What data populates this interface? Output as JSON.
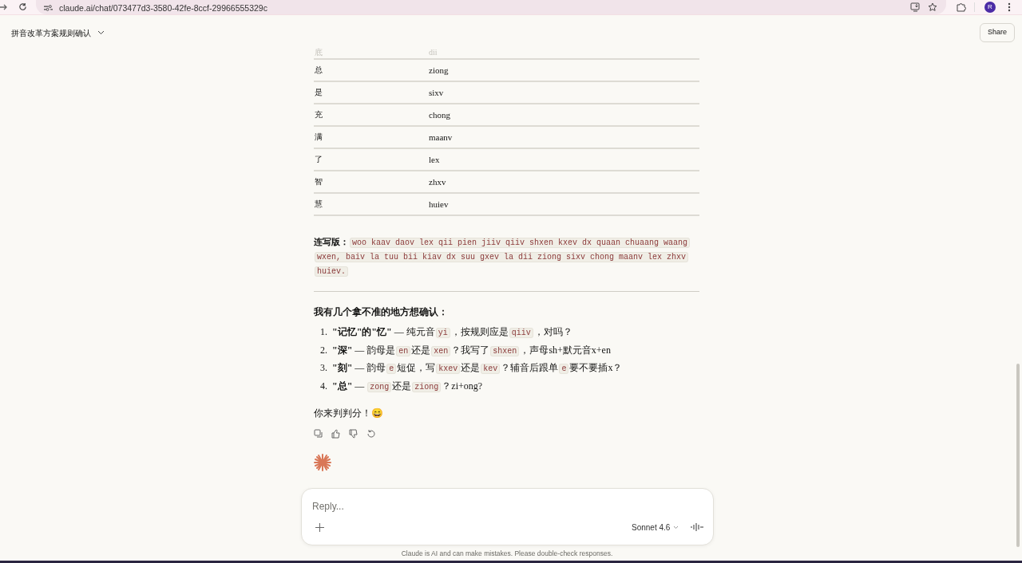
{
  "browser": {
    "url": "claude.ai/chat/073477d3-3580-42fe-8ccf-29966555329c",
    "avatar": "R"
  },
  "header": {
    "title": "拼音改革方案规则确认",
    "share": "Share"
  },
  "table": {
    "rows": [
      {
        "char": "底",
        "pinyin": "dii",
        "faded": true
      },
      {
        "char": "总",
        "pinyin": "ziong",
        "faded": false
      },
      {
        "char": "是",
        "pinyin": "sixv",
        "faded": false
      },
      {
        "char": "充",
        "pinyin": "chong",
        "faded": false
      },
      {
        "char": "满",
        "pinyin": "maanv",
        "faded": false
      },
      {
        "char": "了",
        "pinyin": "lex",
        "faded": false
      },
      {
        "char": "智",
        "pinyin": "zhxv",
        "faded": false
      },
      {
        "char": "慧",
        "pinyin": "huiev",
        "faded": false
      }
    ]
  },
  "continuous": [
    {
      "kind": "bold",
      "text": "连写版："
    },
    {
      "kind": "code",
      "text": "woo kaav daov lex qii pien jiiv qiiv shxen kxev dx quaan chuaang waang wxen, baiv la tuu bii kiav dx suu gxev la dii ziong sixv chong maanv lex zhxv huiev."
    }
  ],
  "heading": "我有几个拿不准的地方想确认：",
  "questions": [
    {
      "number": "1.",
      "parts": [
        {
          "kind": "bold",
          "text": "\"记忆\"的\"忆\""
        },
        {
          "kind": "text",
          "text": " — 纯元音"
        },
        {
          "kind": "code",
          "text": "yi"
        },
        {
          "kind": "text",
          "text": "，按规则应是"
        },
        {
          "kind": "code",
          "text": "qiiv"
        },
        {
          "kind": "text",
          "text": "，对吗？"
        }
      ]
    },
    {
      "number": "2.",
      "parts": [
        {
          "kind": "bold",
          "text": "\"深\""
        },
        {
          "kind": "text",
          "text": " — 韵母是"
        },
        {
          "kind": "code",
          "text": "en"
        },
        {
          "kind": "text",
          "text": "还是"
        },
        {
          "kind": "code",
          "text": "xen"
        },
        {
          "kind": "text",
          "text": "？我写了"
        },
        {
          "kind": "code",
          "text": "shxen"
        },
        {
          "kind": "text",
          "text": "，声母sh+默元音x+en"
        }
      ]
    },
    {
      "number": "3.",
      "parts": [
        {
          "kind": "bold",
          "text": "\"刻\""
        },
        {
          "kind": "text",
          "text": " — 韵母"
        },
        {
          "kind": "code",
          "text": "e"
        },
        {
          "kind": "text",
          "text": "短促，写"
        },
        {
          "kind": "code",
          "text": "kxev"
        },
        {
          "kind": "text",
          "text": "还是"
        },
        {
          "kind": "code",
          "text": "kev"
        },
        {
          "kind": "text",
          "text": "？辅音后跟单"
        },
        {
          "kind": "code",
          "text": "e"
        },
        {
          "kind": "text",
          "text": "要不要插x？"
        }
      ]
    },
    {
      "number": "4.",
      "parts": [
        {
          "kind": "bold",
          "text": "\"总\""
        },
        {
          "kind": "text",
          "text": " — "
        },
        {
          "kind": "code",
          "text": "zong"
        },
        {
          "kind": "text",
          "text": "还是"
        },
        {
          "kind": "code",
          "text": "ziong"
        },
        {
          "kind": "text",
          "text": "？zi+ong?"
        }
      ]
    }
  ],
  "closing": "你来判判分！😄",
  "composer": {
    "placeholder": "Reply...",
    "model": "Sonnet 4.6"
  },
  "disclaimer": "Claude is AI and can make mistakes. Please double-check responses."
}
